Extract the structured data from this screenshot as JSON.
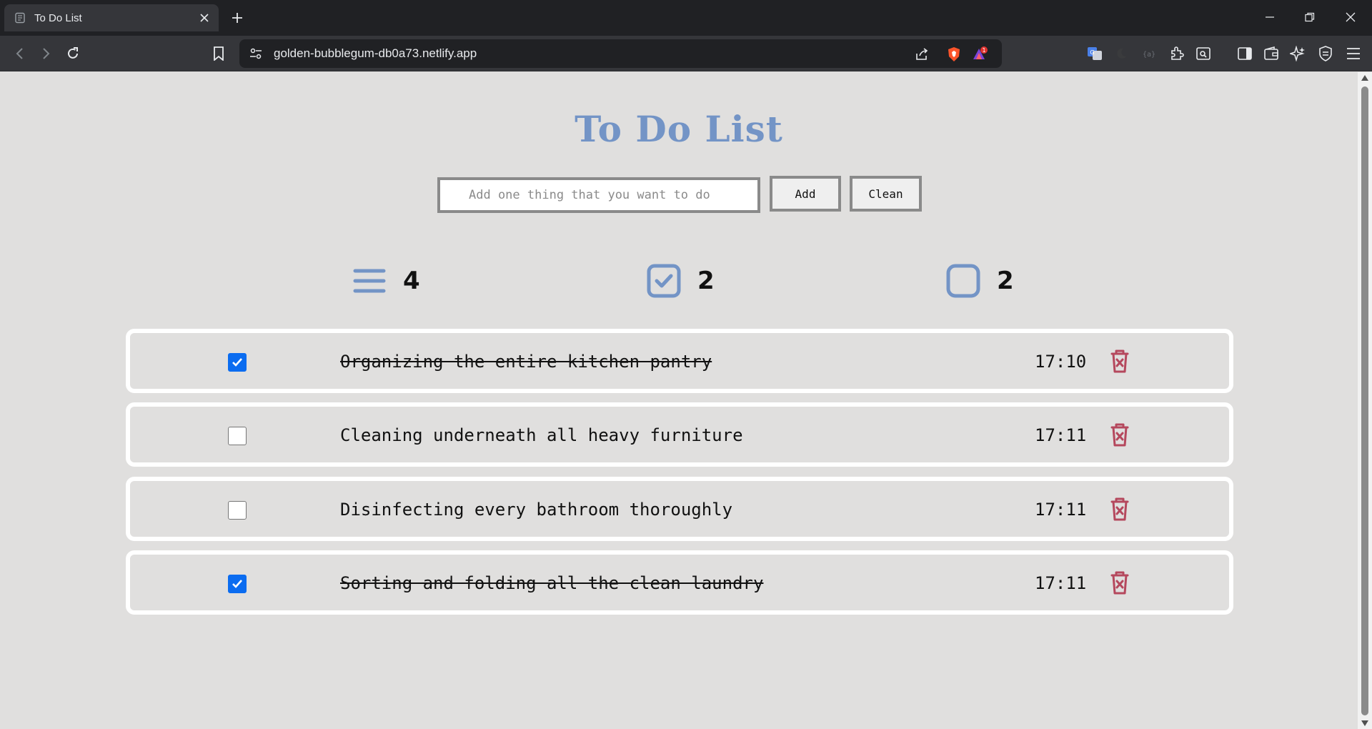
{
  "browser": {
    "tab_title": "To Do List",
    "url": "golden-bubblegum-db0a73.netlify.app",
    "notification_count": "1"
  },
  "app": {
    "title": "To Do List",
    "input_placeholder": "Add one thing that you want to do",
    "input_value": "",
    "add_label": "Add",
    "clean_label": "Clean",
    "accent_color": "#7394c6",
    "delete_color": "#b5485d"
  },
  "stats": {
    "total": "4",
    "completed": "2",
    "pending": "2"
  },
  "todos": [
    {
      "text": "Organizing the entire kitchen pantry",
      "time": "17:10",
      "done": true
    },
    {
      "text": "Cleaning underneath all heavy furniture",
      "time": "17:11",
      "done": false
    },
    {
      "text": "Disinfecting every bathroom thoroughly",
      "time": "17:11",
      "done": false
    },
    {
      "text": "Sorting and folding all the clean laundry",
      "time": "17:11",
      "done": true
    }
  ]
}
